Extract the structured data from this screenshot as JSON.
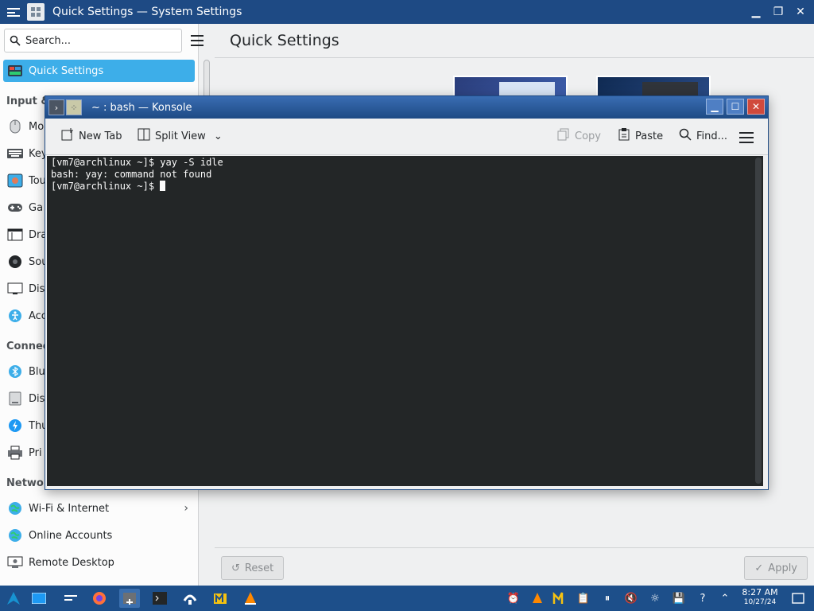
{
  "settings_window": {
    "title": "Quick Settings — System Settings",
    "search_placeholder": "Search...",
    "page_title": "Quick Settings",
    "sidebar": {
      "active_item": "Quick Settings",
      "categories": [
        "Input &",
        "Connec",
        "Networ"
      ],
      "items": [
        "Mo",
        "Key",
        "Tou",
        "Ga",
        "Dra",
        "Sou",
        "Dis",
        "Acc",
        "Blu",
        "Dis",
        "Thu",
        "Pri",
        "Wi-Fi & Internet",
        "Online Accounts",
        "Remote Desktop"
      ]
    },
    "footer": {
      "reset_label": "Reset",
      "apply_label": "Apply"
    }
  },
  "konsole": {
    "title": "~ : bash — Konsole",
    "toolbar": {
      "new_tab": "New Tab",
      "split_view": "Split View",
      "copy": "Copy",
      "paste": "Paste",
      "find": "Find..."
    },
    "terminal_lines": [
      "[vm7@archlinux ~]$ yay -S idle",
      "bash: yay: command not found",
      "[vm7@archlinux ~]$ "
    ]
  },
  "taskbar": {
    "clock_time": "8:27 AM",
    "clock_date": "10/27/24"
  }
}
